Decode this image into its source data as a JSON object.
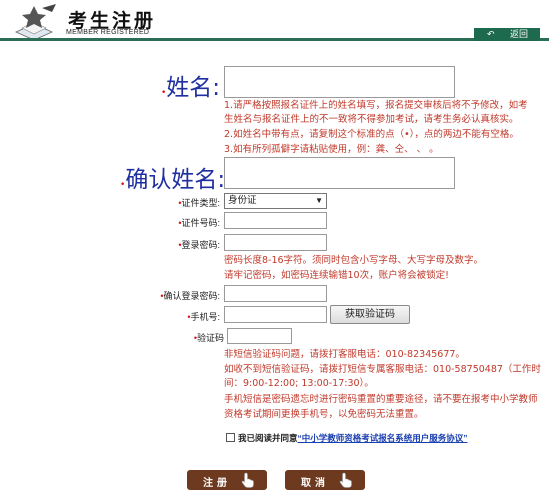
{
  "header": {
    "title": "考生注册",
    "subtitle": "MEMBER REGISTERED",
    "back_label": "返回",
    "back_icon": "back-arrow-icon",
    "accent_color": "#1e6a4e"
  },
  "name_field": {
    "label": "姓名:",
    "value": "",
    "notes": [
      "1.请严格按照报名证件上的姓名填写，报名提交审核后将不予修改，如考",
      "生姓名与报名证件上的不一致将不得参加考试，请考生务必认真核实。",
      "2.如姓名中带有点，请复制这个标准的点（•），点的两边不能有空格。",
      "3.如有所列孤僻字请粘贴使用，例：龚、仝、   、   。"
    ]
  },
  "confirm_name": {
    "label": "确认姓名:",
    "value": ""
  },
  "id_type": {
    "label": "证件类型:",
    "value": "身份证"
  },
  "id_number": {
    "label": "证件号码:",
    "value": ""
  },
  "password": {
    "label": "登录密码:",
    "value": "",
    "notes": [
      "密码长度8-16字符。须同时包含小写字母、大写字母及数字。",
      "请牢记密码，如密码连续输错10次，账户将会被锁定!"
    ]
  },
  "confirm_password": {
    "label": "确认登录密码:",
    "value": ""
  },
  "phone": {
    "label": "手机号:",
    "value": "",
    "sms_button": "获取验证码"
  },
  "captcha": {
    "label": "验证码",
    "value": "",
    "notes": [
      "非短信验证码问题，请拨打客服电话：010-82345677。",
      "如收不到短信验证码，请拨打短信专属客服电话：010-58750487（工作时",
      "间：9:00-12:00; 13:00-17:30）。",
      "手机短信是密码遗忘时进行密码重置的重要途径，请不要在报考中小学教师",
      "资格考试期间更换手机号，以免密码无法重置。"
    ]
  },
  "agreement": {
    "prefix": "我已阅读并同意",
    "link": "“中小学教师资格考试报名系统用户服务协议”",
    "checked": false
  },
  "buttons": {
    "register": "注册",
    "cancel": "取消",
    "button_color": "#6e3a1f"
  }
}
